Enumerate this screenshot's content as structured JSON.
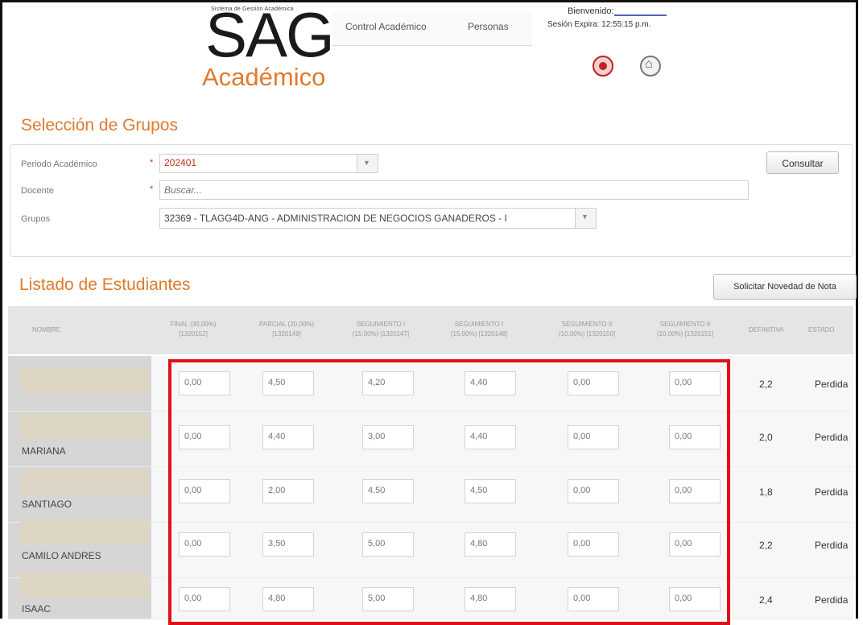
{
  "header": {
    "logo_small": "Sistema de Gestión Académica",
    "logo_main": "SAG",
    "logo_sub": "Académico",
    "nav": [
      "Control Académico",
      "Personas"
    ],
    "welcome": "Bienvenido:",
    "session": "Sesión Expira: 12:55:15 p.m.",
    "icons": [
      "logout-icon",
      "home-icon"
    ]
  },
  "groups_section": {
    "title": "Selección de Grupos",
    "periodo_label": "Periodo Académico",
    "periodo_value": "202401",
    "docente_label": "Docente",
    "docente_placeholder": "Buscar...",
    "grupos_label": "Grupos",
    "grupos_value": "32369 - TLAGG4D-ANG - ADMINISTRACION DE NEGOCIOS GANADEROS - I",
    "required_mark": "*",
    "consultar_label": "Consultar"
  },
  "students_section": {
    "title": "Listado de Estudiantes",
    "solicitar_label": "Solicitar Novedad de Nota",
    "columns": [
      {
        "line1": "NOMBRE",
        "line2": ""
      },
      {
        "line1": "FINAL (30,00%)",
        "line2": "[1320152]"
      },
      {
        "line1": "PARCIAL (20,00%)",
        "line2": "[1320149]"
      },
      {
        "line1": "SEGUIMIENTO I",
        "line2": "(15,00%) [1320147]"
      },
      {
        "line1": "SEGUIMIENTO I",
        "line2": "(15,00%) [1320148]"
      },
      {
        "line1": "SEGUIMIENTO II",
        "line2": "(10,00%) [1320150]"
      },
      {
        "line1": "SEGUIMIENTO II",
        "line2": "(10,00%) [1320151]"
      },
      {
        "line1": "DEFINITIVA",
        "line2": ""
      },
      {
        "line1": "ESTADO",
        "line2": ""
      }
    ],
    "rows": [
      {
        "name": "",
        "grades": [
          "0,00",
          "4,50",
          "4,20",
          "4,40",
          "0,00",
          "0,00"
        ],
        "definitiva": "2,2",
        "estado": "Perdida"
      },
      {
        "name": "MARIANA",
        "grades": [
          "0,00",
          "4,40",
          "3,00",
          "4,40",
          "0,00",
          "0,00"
        ],
        "definitiva": "2,0",
        "estado": "Perdida"
      },
      {
        "name": "SANTIAGO",
        "grades": [
          "0,00",
          "2,00",
          "4,50",
          "4,50",
          "0,00",
          "0,00"
        ],
        "definitiva": "1,8",
        "estado": "Perdida"
      },
      {
        "name": "CAMILO ANDRES",
        "grades": [
          "0,00",
          "3,50",
          "5,00",
          "4,80",
          "0,00",
          "0,00"
        ],
        "definitiva": "2,2",
        "estado": "Perdida"
      },
      {
        "name": "ISAAC",
        "grades": [
          "0,00",
          "4,80",
          "5,00",
          "4,80",
          "0,00",
          "0,00"
        ],
        "definitiva": "2,4",
        "estado": "Perdida"
      }
    ]
  },
  "colors": {
    "accent": "#e07a2e",
    "highlight": "#e0101a",
    "required": "#d03030"
  }
}
